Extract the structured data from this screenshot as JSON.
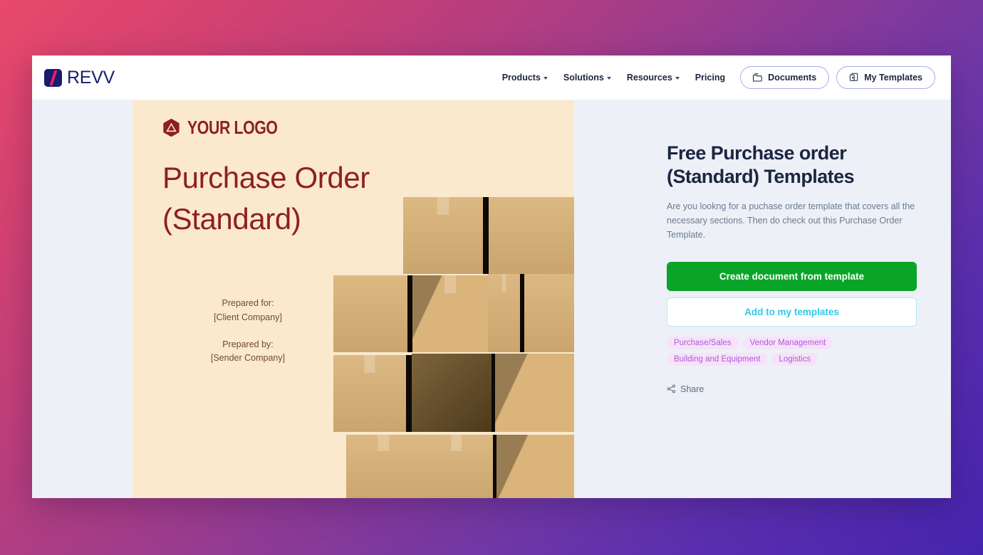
{
  "header": {
    "logo": {
      "word": "REVV",
      "icon": "revv-slash-logo"
    },
    "nav_items": [
      {
        "label": "Products",
        "has_caret": true
      },
      {
        "label": "Solutions",
        "has_caret": true
      },
      {
        "label": "Resources",
        "has_caret": true
      },
      {
        "label": "Pricing",
        "has_caret": false
      }
    ],
    "pills": [
      {
        "label": "Documents",
        "icon": "folder-icon"
      },
      {
        "label": "My Templates",
        "icon": "template-add-icon"
      }
    ]
  },
  "document_preview": {
    "logo_text": "YOUR LOGO",
    "logo_icon": "hexagon-triangle-icon",
    "title_line1": "Purchase Order",
    "title_line2": "(Standard)",
    "prepared_for_label": "Prepared for:",
    "prepared_for_value": "[Client Company]",
    "prepared_by_label": "Prepared by:",
    "prepared_by_value": "[Sender Company]",
    "photo_alt": "stacked-cardboard-boxes-photo"
  },
  "info_panel": {
    "title": "Free Purchase order (Standard) Templates",
    "description": "Are you lookng for a puchase order template that covers all the necessary sections. Then do check out this Purchase Order Template.",
    "primary_cta": "Create document from template",
    "secondary_cta": "Add to my templates",
    "tags": [
      "Purchase/Sales",
      "Vendor Management",
      "Building and Equipment",
      "Logistics"
    ],
    "share_label": "Share",
    "share_icon": "share-nodes-icon"
  },
  "colors": {
    "brand_navy": "#181d6e",
    "brand_pink": "#ee1d6a",
    "primary_green": "#0aa528",
    "secondary_cyan": "#31c8e8",
    "tag_text": "#ad5ad8",
    "tag_bg": "#f7e2fa",
    "doc_cream": "#fbe9cd",
    "doc_red": "#8d2024",
    "panel_bg": "#edf1f7"
  }
}
